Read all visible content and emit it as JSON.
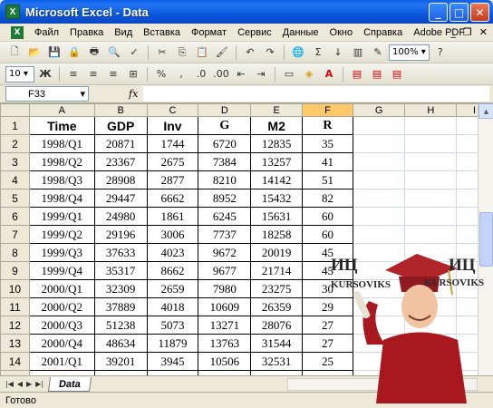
{
  "window": {
    "title": "Microsoft Excel - Data",
    "app_icon": "X",
    "doc_icon": "X"
  },
  "menu": {
    "items": [
      "Файл",
      "Правка",
      "Вид",
      "Вставка",
      "Формат",
      "Сервис",
      "Данные",
      "Окно",
      "Справка",
      "Adobe PDF"
    ]
  },
  "toolbar": {
    "zoom": "100%",
    "font_size": "10",
    "bold": "Ж"
  },
  "formula_bar": {
    "name_box": "F33",
    "fx": "fx",
    "value": ""
  },
  "columns": [
    "A",
    "B",
    "C",
    "D",
    "E",
    "F",
    "G",
    "H",
    "I"
  ],
  "selected_column": "F",
  "header_row": [
    "Time",
    "GDP",
    "Inv",
    "G",
    "M2",
    "R"
  ],
  "rows": [
    [
      "1998/Q1",
      "20871",
      "1744",
      "6720",
      "12835",
      "35"
    ],
    [
      "1998/Q2",
      "23367",
      "2675",
      "7384",
      "13257",
      "41"
    ],
    [
      "1998/Q3",
      "28908",
      "2877",
      "8210",
      "14142",
      "51"
    ],
    [
      "1998/Q4",
      "29447",
      "6662",
      "8952",
      "15432",
      "82"
    ],
    [
      "1999/Q1",
      "24980",
      "1861",
      "6245",
      "15631",
      "60"
    ],
    [
      "1999/Q2",
      "29196",
      "3006",
      "7737",
      "18258",
      "60"
    ],
    [
      "1999/Q3",
      "37633",
      "4023",
      "9672",
      "20019",
      "45"
    ],
    [
      "1999/Q4",
      "35317",
      "8662",
      "9677",
      "21714",
      "45"
    ],
    [
      "2000/Q1",
      "32309",
      "2659",
      "7980",
      "23275",
      "30"
    ],
    [
      "2000/Q2",
      "37889",
      "4018",
      "10609",
      "26359",
      "29"
    ],
    [
      "2000/Q3",
      "51238",
      "5073",
      "13271",
      "28076",
      "27"
    ],
    [
      "2000/Q4",
      "48634",
      "11879",
      "13763",
      "31544",
      "27"
    ],
    [
      "2001/Q1",
      "39201",
      "3945",
      "10506",
      "32531",
      "25"
    ],
    [
      "2001/Q2",
      "46481",
      "6062",
      "12782",
      "36552",
      "19"
    ]
  ],
  "sheet_tab": "Data",
  "status": "Готово",
  "watermark": {
    "left": "ИЦ",
    "left_sub": "KURSOVIKS",
    "right": "ИЦ",
    "right_sub": "KURSOVIKS"
  }
}
